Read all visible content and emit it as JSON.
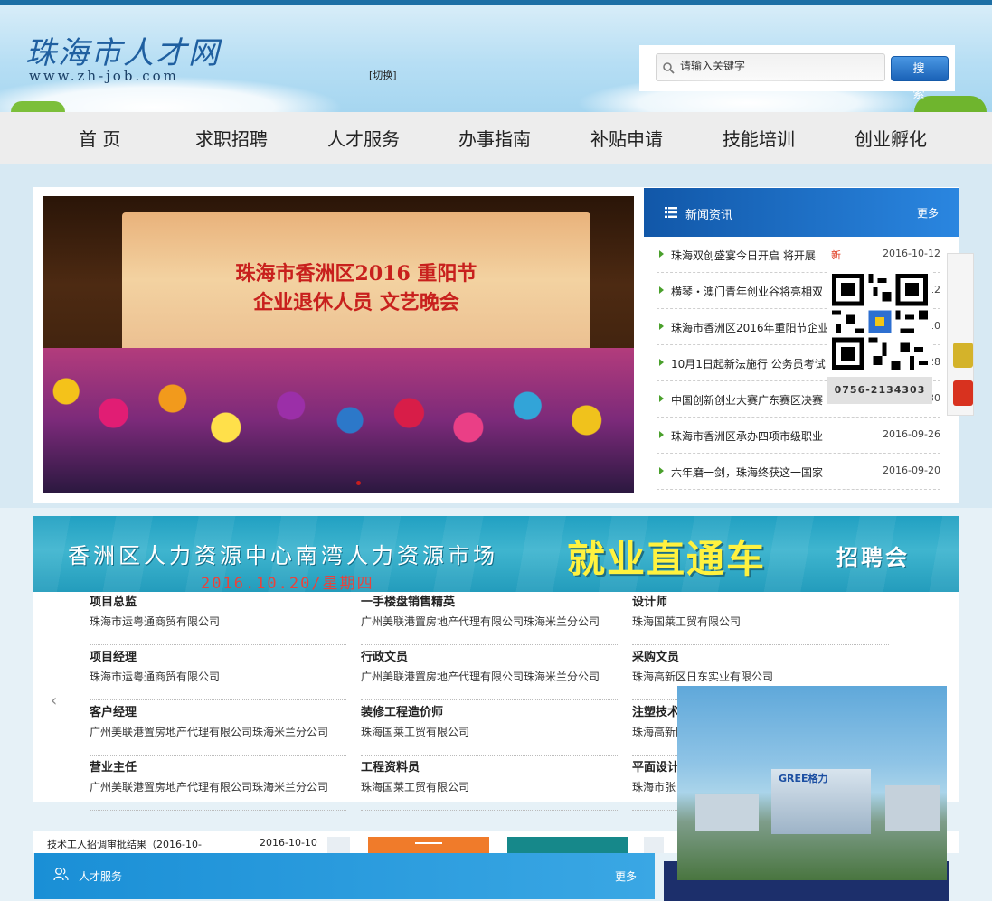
{
  "header": {
    "site_title": "珠海市人才网",
    "site_url": "www.zh-job.com",
    "switch_open": "[",
    "switch_label": "切换",
    "switch_close": "]"
  },
  "search": {
    "placeholder": "请输入关键字",
    "button_label": "搜 索"
  },
  "nav": {
    "items": [
      "首 页",
      "求职招聘",
      "人才服务",
      "办事指南",
      "补贴申请",
      "技能培训",
      "创业孵化"
    ]
  },
  "banner": {
    "line1": "珠海市香洲区2016 重阳节",
    "line2": "企业退休人员 文艺晚会"
  },
  "news": {
    "title": "新闻资讯",
    "more": "更多",
    "items": [
      {
        "title": "珠海双创盛宴今日开启 将开展",
        "badge": "新",
        "date": "2016-10-12"
      },
      {
        "title": "横琴・澳门青年创业谷将亮相双",
        "badge": "",
        "date": "2016-10-12"
      },
      {
        "title": "珠海市香洲区2016年重阳节企业",
        "badge": "",
        "date": "2016-10-10"
      },
      {
        "title": "10月1日起新法施行 公务员考试",
        "badge": "",
        "date": "2016-09-28"
      },
      {
        "title": "中国创新创业大赛广东赛区决赛",
        "badge": "",
        "date": "2016-09-30"
      },
      {
        "title": "珠海市香洲区承办四项市级职业",
        "badge": "",
        "date": "2016-09-26"
      },
      {
        "title": "六年磨一剑，珠海终获这一国家",
        "badge": "",
        "date": "2016-09-20"
      }
    ]
  },
  "qr": {
    "phone": "0756-2134303"
  },
  "fair": {
    "title": "香洲区人力资源中心南湾人力资源市场",
    "date": "2016.10.20/星期四",
    "slogan": "就业直通车",
    "tag": "招聘会"
  },
  "jobs": [
    {
      "position": "项目总监",
      "company": "珠海市运粤通商贸有限公司"
    },
    {
      "position": "一手楼盘销售精英",
      "company": "广州美联港置房地产代理有限公司珠海米兰分公司"
    },
    {
      "position": "设计师",
      "company": "珠海国莱工贸有限公司"
    },
    {
      "position": "项目经理",
      "company": "珠海市运粤通商贸有限公司"
    },
    {
      "position": "行政文员",
      "company": "广州美联港置房地产代理有限公司珠海米兰分公司"
    },
    {
      "position": "采购文员",
      "company": "珠海高新区日东实业有限公司"
    },
    {
      "position": "客户经理",
      "company": "广州美联港置房地产代理有限公司珠海米兰分公司"
    },
    {
      "position": "装修工程造价师",
      "company": "珠海国莱工贸有限公司"
    },
    {
      "position": "注塑技术",
      "company": "珠海高新区"
    },
    {
      "position": "营业主任",
      "company": "广州美联港置房地产代理有限公司珠海米兰分公司"
    },
    {
      "position": "工程资料员",
      "company": "珠海国莱工贸有限公司"
    },
    {
      "position": "平面设计",
      "company": "珠海市张"
    }
  ],
  "bottom": {
    "notice_text": "技术工人招调审批结果（2016-10-",
    "notice_date": "2016-10-10"
  },
  "talent": {
    "title": "人才服务",
    "more": "更多"
  },
  "gree_ad": {
    "logo": "GREE格力"
  }
}
